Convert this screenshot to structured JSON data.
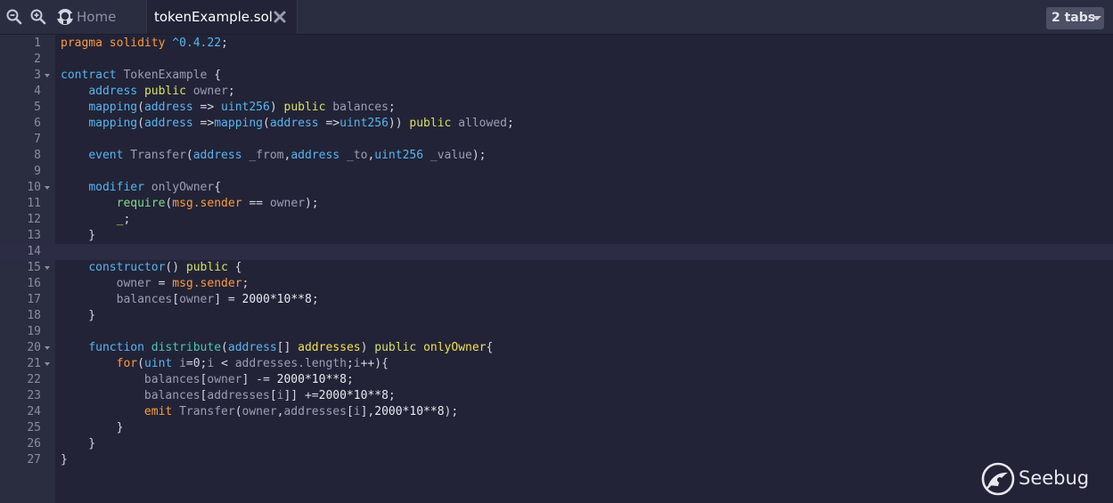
{
  "tabbar": {
    "home_label": "Home",
    "active_tab_label": "tokenExample.sol",
    "tabs_count_label": "2 tabs",
    "icons": [
      "zoom-out-icon",
      "zoom-in-icon",
      "home-icon",
      "close-icon",
      "chevron-down-icon"
    ]
  },
  "editor": {
    "active_line": 14,
    "folded_lines": [
      3,
      10,
      15,
      20,
      21
    ],
    "lines": [
      {
        "n": "1",
        "tokens": [
          {
            "t": "pragma",
            "c": "kw"
          },
          {
            "t": " ",
            "c": "op"
          },
          {
            "t": "solidity",
            "c": "kw"
          },
          {
            "t": " ",
            "c": "op"
          },
          {
            "t": "^0.4.22",
            "c": "ty"
          },
          {
            "t": ";",
            "c": "op"
          }
        ]
      },
      {
        "n": "2",
        "tokens": []
      },
      {
        "n": "3",
        "tokens": [
          {
            "t": "contract",
            "c": "ty"
          },
          {
            "t": " ",
            "c": "op"
          },
          {
            "t": "TokenExample",
            "c": "id"
          },
          {
            "t": " {",
            "c": "op"
          }
        ]
      },
      {
        "n": "4",
        "tokens": [
          {
            "t": "    ",
            "c": "op"
          },
          {
            "t": "address",
            "c": "ty"
          },
          {
            "t": " ",
            "c": "op"
          },
          {
            "t": "public",
            "c": "vis"
          },
          {
            "t": " ",
            "c": "op"
          },
          {
            "t": "owner",
            "c": "id"
          },
          {
            "t": ";",
            "c": "op"
          }
        ]
      },
      {
        "n": "5",
        "tokens": [
          {
            "t": "    ",
            "c": "op"
          },
          {
            "t": "mapping",
            "c": "ty"
          },
          {
            "t": "(",
            "c": "op"
          },
          {
            "t": "address",
            "c": "ty"
          },
          {
            "t": " => ",
            "c": "op"
          },
          {
            "t": "uint256",
            "c": "ty"
          },
          {
            "t": ") ",
            "c": "op"
          },
          {
            "t": "public",
            "c": "vis"
          },
          {
            "t": " ",
            "c": "op"
          },
          {
            "t": "balances",
            "c": "id"
          },
          {
            "t": ";",
            "c": "op"
          }
        ]
      },
      {
        "n": "6",
        "tokens": [
          {
            "t": "    ",
            "c": "op"
          },
          {
            "t": "mapping",
            "c": "ty"
          },
          {
            "t": "(",
            "c": "op"
          },
          {
            "t": "address",
            "c": "ty"
          },
          {
            "t": " =>",
            "c": "op"
          },
          {
            "t": "mapping",
            "c": "ty"
          },
          {
            "t": "(",
            "c": "op"
          },
          {
            "t": "address",
            "c": "ty"
          },
          {
            "t": " =>",
            "c": "op"
          },
          {
            "t": "uint256",
            "c": "ty"
          },
          {
            "t": ")) ",
            "c": "op"
          },
          {
            "t": "public",
            "c": "vis"
          },
          {
            "t": " ",
            "c": "op"
          },
          {
            "t": "allowed",
            "c": "id"
          },
          {
            "t": ";",
            "c": "op"
          }
        ]
      },
      {
        "n": "7",
        "tokens": []
      },
      {
        "n": "8",
        "tokens": [
          {
            "t": "    ",
            "c": "op"
          },
          {
            "t": "event",
            "c": "ty"
          },
          {
            "t": " ",
            "c": "op"
          },
          {
            "t": "Transfer",
            "c": "id"
          },
          {
            "t": "(",
            "c": "op"
          },
          {
            "t": "address",
            "c": "ty"
          },
          {
            "t": " ",
            "c": "op"
          },
          {
            "t": "_from",
            "c": "id"
          },
          {
            "t": ",",
            "c": "op"
          },
          {
            "t": "address",
            "c": "ty"
          },
          {
            "t": " ",
            "c": "op"
          },
          {
            "t": "_to",
            "c": "id"
          },
          {
            "t": ",",
            "c": "op"
          },
          {
            "t": "uint256",
            "c": "ty"
          },
          {
            "t": " ",
            "c": "op"
          },
          {
            "t": "_value",
            "c": "id"
          },
          {
            "t": ");",
            "c": "op"
          }
        ]
      },
      {
        "n": "9",
        "tokens": []
      },
      {
        "n": "10",
        "tokens": [
          {
            "t": "    ",
            "c": "op"
          },
          {
            "t": "modifier",
            "c": "ty"
          },
          {
            "t": " ",
            "c": "op"
          },
          {
            "t": "onlyOwner",
            "c": "id"
          },
          {
            "t": "{",
            "c": "op"
          }
        ]
      },
      {
        "n": "11",
        "tokens": [
          {
            "t": "        ",
            "c": "op"
          },
          {
            "t": "require",
            "c": "req"
          },
          {
            "t": "(",
            "c": "op"
          },
          {
            "t": "msg.sender",
            "c": "msg"
          },
          {
            "t": " == ",
            "c": "op"
          },
          {
            "t": "owner",
            "c": "id"
          },
          {
            "t": ");",
            "c": "op"
          }
        ]
      },
      {
        "n": "12",
        "tokens": [
          {
            "t": "        ",
            "c": "op"
          },
          {
            "t": "_",
            "c": "mod"
          },
          {
            "t": ";",
            "c": "op"
          }
        ]
      },
      {
        "n": "13",
        "tokens": [
          {
            "t": "    }",
            "c": "op"
          }
        ]
      },
      {
        "n": "14",
        "tokens": []
      },
      {
        "n": "15",
        "tokens": [
          {
            "t": "    ",
            "c": "op"
          },
          {
            "t": "constructor",
            "c": "ty"
          },
          {
            "t": "() ",
            "c": "op"
          },
          {
            "t": "public",
            "c": "vis"
          },
          {
            "t": " {",
            "c": "op"
          }
        ]
      },
      {
        "n": "16",
        "tokens": [
          {
            "t": "        ",
            "c": "op"
          },
          {
            "t": "owner",
            "c": "id"
          },
          {
            "t": " = ",
            "c": "op"
          },
          {
            "t": "msg.sender",
            "c": "msg"
          },
          {
            "t": ";",
            "c": "op"
          }
        ]
      },
      {
        "n": "17",
        "tokens": [
          {
            "t": "        ",
            "c": "op"
          },
          {
            "t": "balances",
            "c": "id"
          },
          {
            "t": "[",
            "c": "op"
          },
          {
            "t": "owner",
            "c": "id"
          },
          {
            "t": "] = ",
            "c": "op"
          },
          {
            "t": "2000*10**8",
            "c": "num"
          },
          {
            "t": ";",
            "c": "op"
          }
        ]
      },
      {
        "n": "18",
        "tokens": [
          {
            "t": "    }",
            "c": "op"
          }
        ]
      },
      {
        "n": "19",
        "tokens": []
      },
      {
        "n": "20",
        "tokens": [
          {
            "t": "    ",
            "c": "op"
          },
          {
            "t": "function",
            "c": "ty"
          },
          {
            "t": " ",
            "c": "op"
          },
          {
            "t": "distribute",
            "c": "fn"
          },
          {
            "t": "(",
            "c": "op"
          },
          {
            "t": "address",
            "c": "ty"
          },
          {
            "t": "[] ",
            "c": "op"
          },
          {
            "t": "addresses",
            "c": "mod"
          },
          {
            "t": ") ",
            "c": "op"
          },
          {
            "t": "public",
            "c": "vis"
          },
          {
            "t": " ",
            "c": "op"
          },
          {
            "t": "onlyOwner",
            "c": "mod"
          },
          {
            "t": "{",
            "c": "op"
          }
        ]
      },
      {
        "n": "21",
        "tokens": [
          {
            "t": "        ",
            "c": "op"
          },
          {
            "t": "for",
            "c": "kw"
          },
          {
            "t": "(",
            "c": "op"
          },
          {
            "t": "uint",
            "c": "ty"
          },
          {
            "t": " ",
            "c": "op"
          },
          {
            "t": "i",
            "c": "id"
          },
          {
            "t": "=0;",
            "c": "op"
          },
          {
            "t": "i",
            "c": "id"
          },
          {
            "t": " < ",
            "c": "op"
          },
          {
            "t": "addresses.length",
            "c": "id"
          },
          {
            "t": ";",
            "c": "op"
          },
          {
            "t": "i",
            "c": "id"
          },
          {
            "t": "++){",
            "c": "op"
          }
        ]
      },
      {
        "n": "22",
        "tokens": [
          {
            "t": "            ",
            "c": "op"
          },
          {
            "t": "balances",
            "c": "id"
          },
          {
            "t": "[",
            "c": "op"
          },
          {
            "t": "owner",
            "c": "id"
          },
          {
            "t": "] -= ",
            "c": "op"
          },
          {
            "t": "2000*10**8",
            "c": "num"
          },
          {
            "t": ";",
            "c": "op"
          }
        ]
      },
      {
        "n": "23",
        "tokens": [
          {
            "t": "            ",
            "c": "op"
          },
          {
            "t": "balances",
            "c": "id"
          },
          {
            "t": "[",
            "c": "op"
          },
          {
            "t": "addresses",
            "c": "id"
          },
          {
            "t": "[",
            "c": "op"
          },
          {
            "t": "i",
            "c": "id"
          },
          {
            "t": "]] +=",
            "c": "op"
          },
          {
            "t": "2000*10**8",
            "c": "num"
          },
          {
            "t": ";",
            "c": "op"
          }
        ]
      },
      {
        "n": "24",
        "tokens": [
          {
            "t": "            ",
            "c": "op"
          },
          {
            "t": "emit",
            "c": "kw"
          },
          {
            "t": " ",
            "c": "op"
          },
          {
            "t": "Transfer",
            "c": "id"
          },
          {
            "t": "(",
            "c": "op"
          },
          {
            "t": "owner",
            "c": "id"
          },
          {
            "t": ",",
            "c": "op"
          },
          {
            "t": "addresses",
            "c": "id"
          },
          {
            "t": "[",
            "c": "op"
          },
          {
            "t": "i",
            "c": "id"
          },
          {
            "t": "],",
            "c": "op"
          },
          {
            "t": "2000*10**8",
            "c": "num"
          },
          {
            "t": ");",
            "c": "op"
          }
        ]
      },
      {
        "n": "25",
        "tokens": [
          {
            "t": "        }",
            "c": "op"
          }
        ]
      },
      {
        "n": "26",
        "tokens": [
          {
            "t": "    }",
            "c": "op"
          }
        ]
      },
      {
        "n": "27",
        "tokens": [
          {
            "t": "}",
            "c": "op"
          }
        ]
      }
    ]
  },
  "watermark": {
    "text": "Seebug",
    "icon": "seebug-logo-icon"
  },
  "colors": {
    "background": "#222336",
    "gutter": "#2a2c3f",
    "keyword": "#ff9a3d",
    "type": "#56b6f2",
    "visibility": "#d7e062",
    "function": "#48c9b0"
  }
}
